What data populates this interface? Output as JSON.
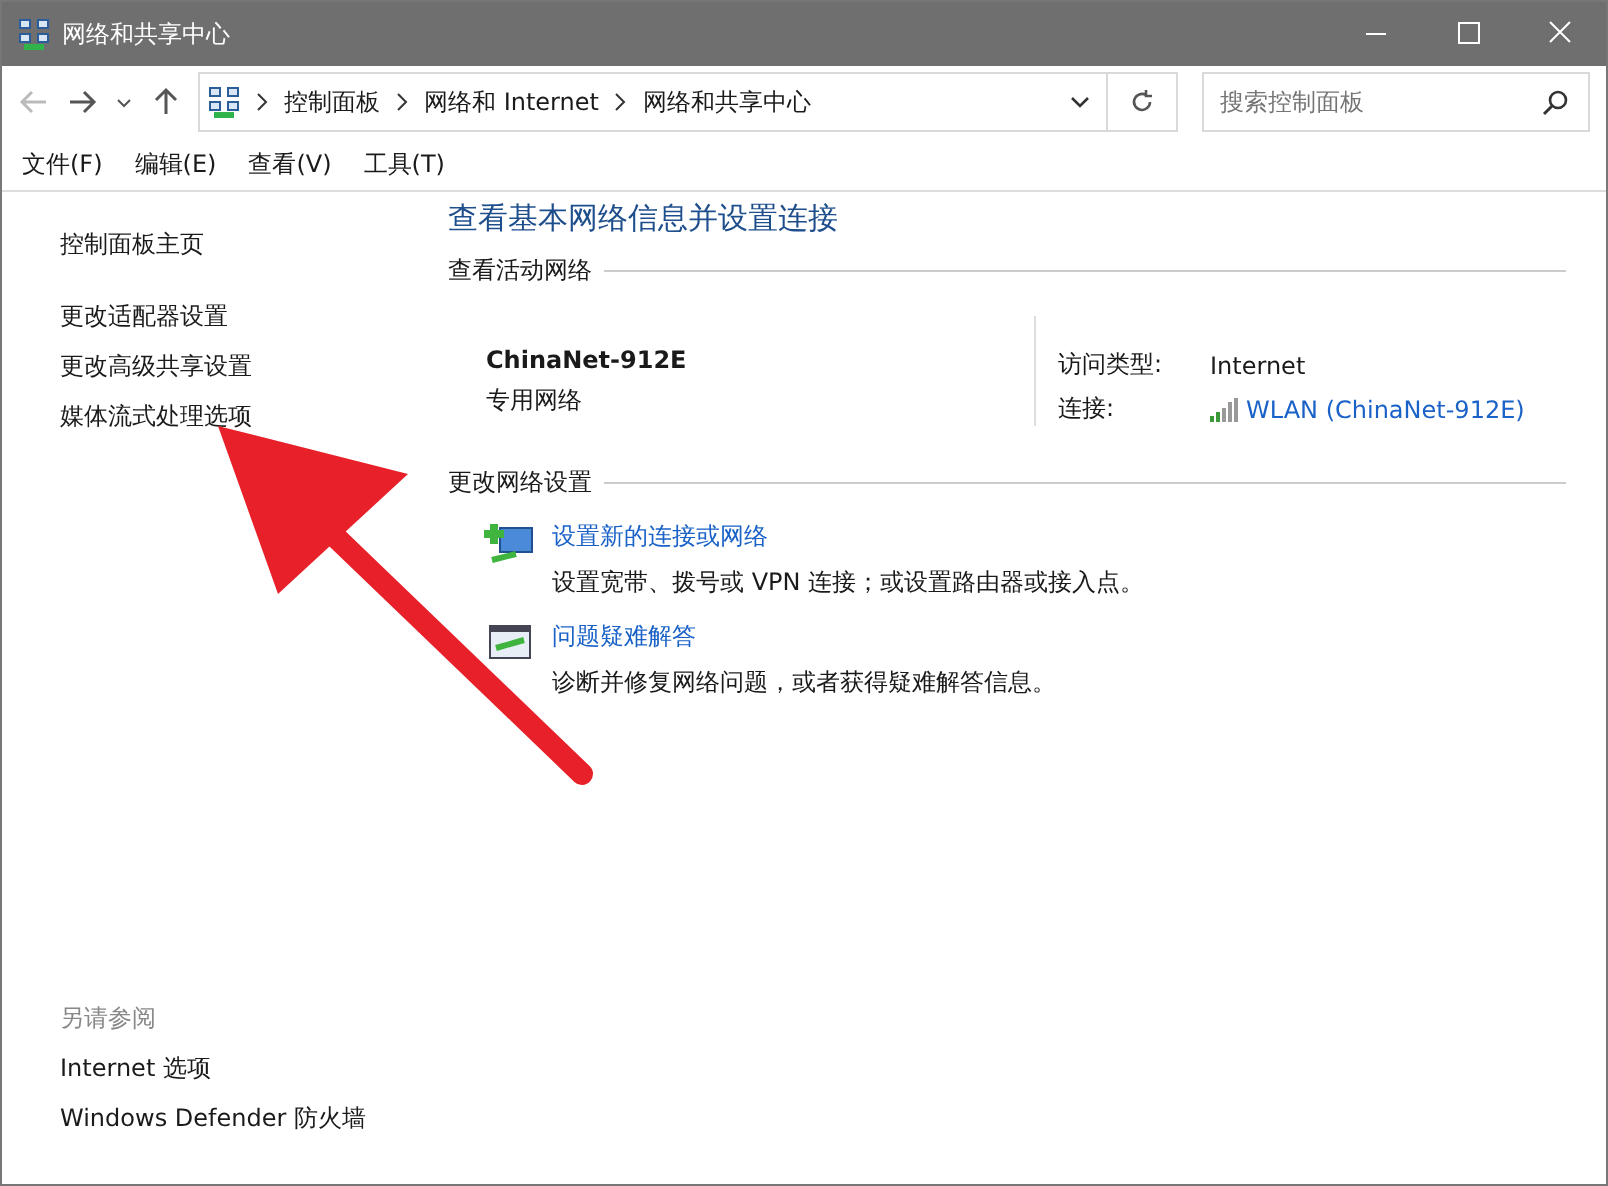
{
  "window": {
    "title": "网络和共享中心"
  },
  "address_bar": {
    "crumbs": [
      "控制面板",
      "网络和 Internet",
      "网络和共享中心"
    ]
  },
  "search": {
    "placeholder": "搜索控制面板"
  },
  "menu": [
    "文件(F)",
    "编辑(E)",
    "查看(V)",
    "工具(T)"
  ],
  "sidebar": {
    "home": "控制面板主页",
    "links": [
      "更改适配器设置",
      "更改高级共享设置",
      "媒体流式处理选项"
    ],
    "see_also_title": "另请参阅",
    "see_also": [
      "Internet 选项",
      "Windows Defender 防火墙"
    ]
  },
  "main": {
    "title": "查看基本网络信息并设置连接",
    "active_section": "查看活动网络",
    "network": {
      "name": "ChinaNet-912E",
      "type": "专用网络"
    },
    "access_label": "访问类型:",
    "access_value": "Internet",
    "connection_label": "连接:",
    "connection_value": "WLAN (ChinaNet-912E)",
    "change_section": "更改网络设置",
    "tasks": [
      {
        "kind": "new-connection",
        "title": "设置新的连接或网络",
        "desc": "设置宽带、拨号或 VPN 连接；或设置路由器或接入点。"
      },
      {
        "kind": "troubleshoot",
        "title": "问题疑难解答",
        "desc": "诊断并修复网络问题，或者获得疑难解答信息。"
      }
    ]
  }
}
